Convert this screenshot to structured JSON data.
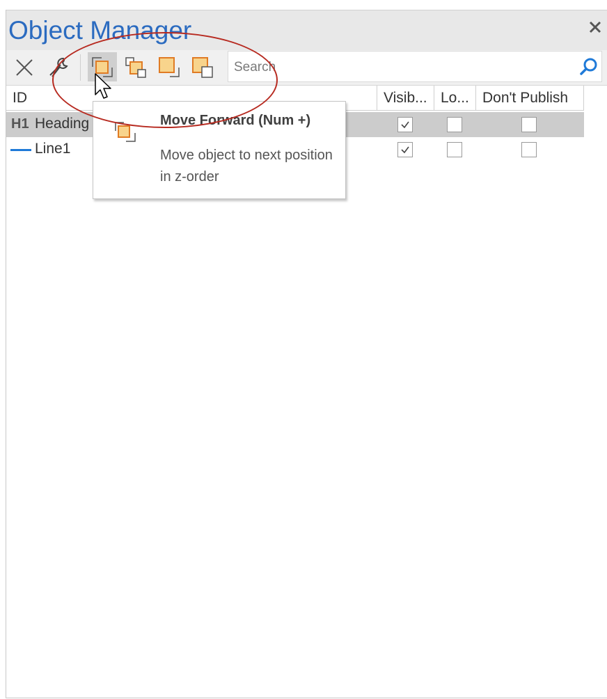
{
  "window": {
    "title": "Object Manager"
  },
  "toolbar": {
    "buttons": [
      {
        "name": "delete",
        "icon": "close-x-icon"
      },
      {
        "name": "properties",
        "icon": "wrench-icon"
      },
      {
        "name": "move-forward",
        "icon": "move-forward-icon",
        "active": true
      },
      {
        "name": "move-backward",
        "icon": "move-backward-icon"
      },
      {
        "name": "bring-to-front",
        "icon": "bring-to-front-icon"
      },
      {
        "name": "send-to-back",
        "icon": "send-to-back-icon"
      }
    ],
    "search": {
      "placeholder": "Search",
      "value": ""
    }
  },
  "grid": {
    "columns": [
      "ID",
      "Visib...",
      "Lo...",
      "Don't Publish"
    ],
    "rows": [
      {
        "badge": "H1",
        "id": "Heading",
        "visible": true,
        "locked": false,
        "dont_publish": false,
        "selected": true
      },
      {
        "badge": "",
        "id": "Line1",
        "visible": true,
        "locked": false,
        "dont_publish": false,
        "selected": false
      }
    ]
  },
  "tooltip": {
    "title": "Move Forward (Num +)",
    "description": "Move object to next position in z-order"
  },
  "colors": {
    "accent": "#2b6bc0",
    "icon_fill": "#f8d48c",
    "icon_stroke": "#e07b24",
    "annotation": "#b72a20",
    "line_icon": "#1f7ad8"
  }
}
